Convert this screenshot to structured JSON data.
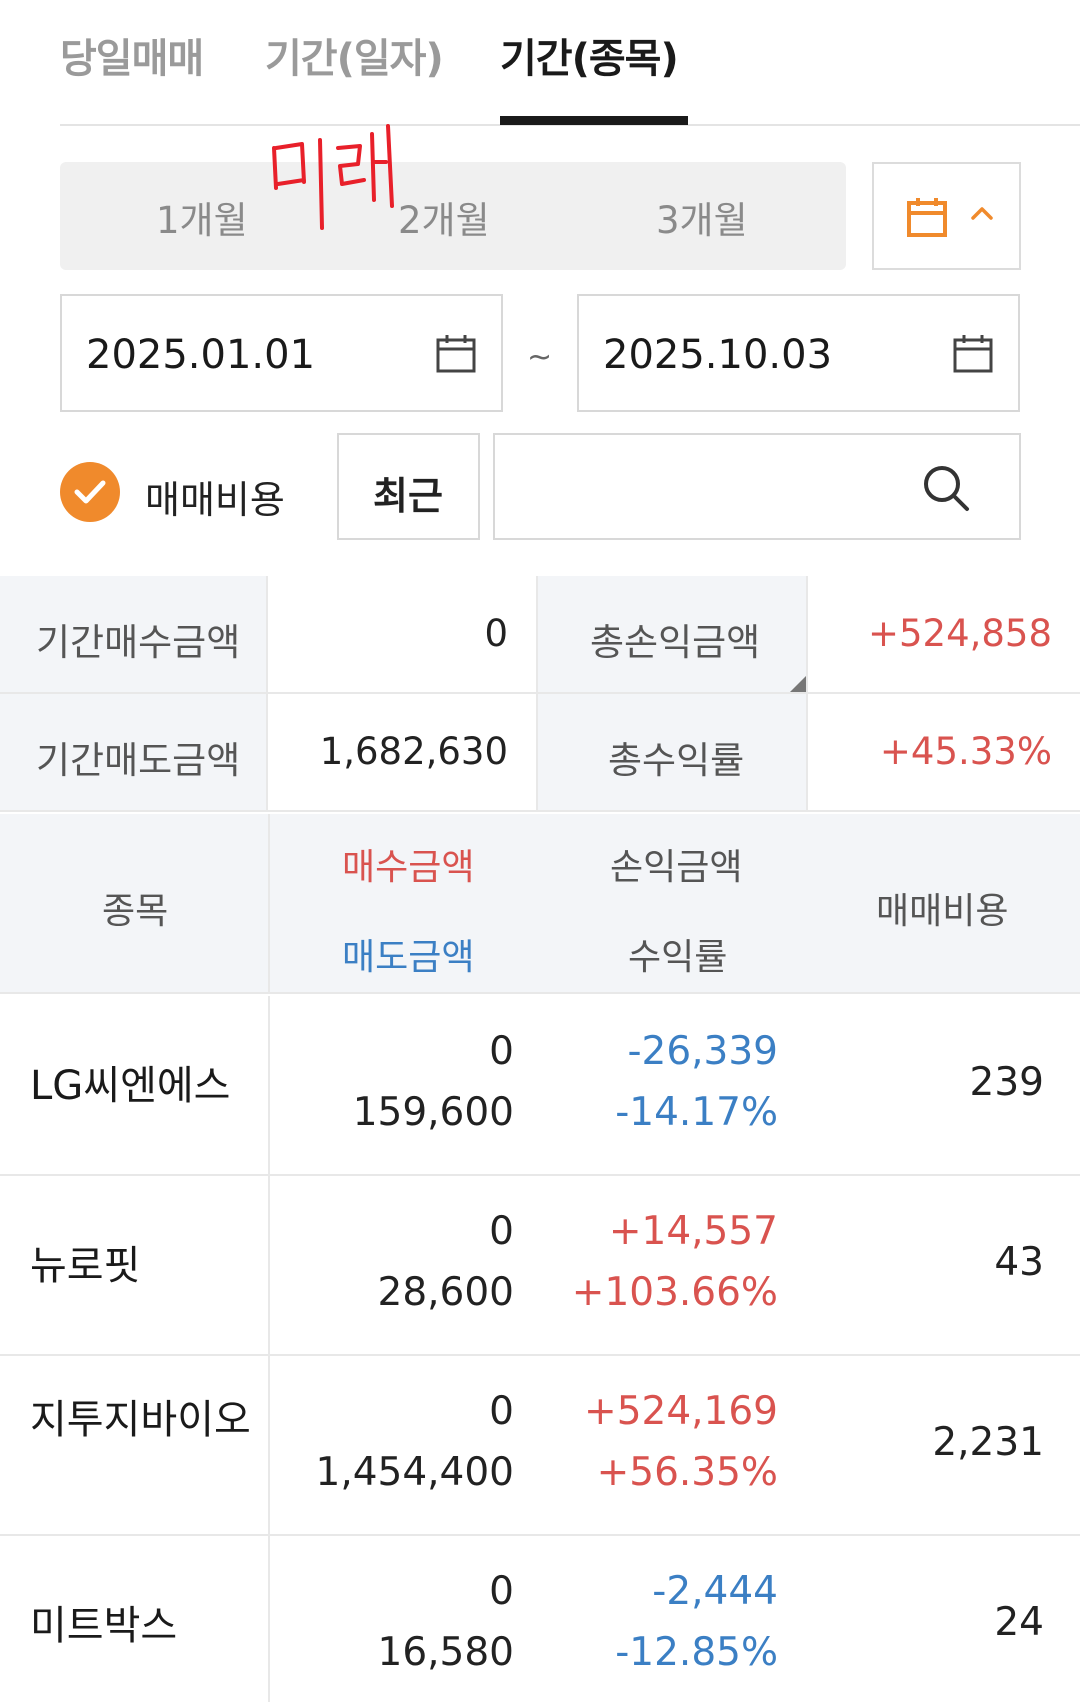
{
  "tabs": [
    {
      "label": "당일매매",
      "active": false
    },
    {
      "label": "기간(일자)",
      "active": false
    },
    {
      "label": "기간(종목)",
      "active": true
    }
  ],
  "period_segments": [
    "1개월",
    "2개월",
    "3개월"
  ],
  "date_range": {
    "from": "2025.01.01",
    "separator": "~",
    "to": "2025.10.03"
  },
  "options": {
    "fee_checkbox_label": "매매비용",
    "fee_checked": true,
    "recent_button": "최근",
    "search_placeholder": ""
  },
  "summary": {
    "period_buy_label": "기간매수금액",
    "period_buy_value": "0",
    "total_pl_label": "총손익금액",
    "total_pl_value": "+524,858",
    "period_sell_label": "기간매도금액",
    "period_sell_value": "1,682,630",
    "total_return_label": "총수익률",
    "total_return_value": "+45.33%"
  },
  "table": {
    "headers": {
      "stock": "종목",
      "buy_amount": "매수금액",
      "sell_amount": "매도금액",
      "profit_amount": "손익금액",
      "return_rate": "수익률",
      "fee": "매매비용"
    },
    "rows": [
      {
        "name": "LG씨엔에스",
        "buy": "0",
        "sell": "159,600",
        "profit": "-26,339",
        "rate": "-14.17%",
        "fee": "239",
        "direction": "down"
      },
      {
        "name": "뉴로핏",
        "buy": "0",
        "sell": "28,600",
        "profit": "+14,557",
        "rate": "+103.66%",
        "fee": "43",
        "direction": "up"
      },
      {
        "name": "지투지바이오",
        "buy": "0",
        "sell": "1,454,400",
        "profit": "+524,169",
        "rate": "+56.35%",
        "fee": "2,231",
        "direction": "up"
      },
      {
        "name": "미트박스",
        "buy": "0",
        "sell": "16,580",
        "profit": "-2,444",
        "rate": "-12.85%",
        "fee": "24",
        "direction": "down"
      }
    ]
  },
  "colors": {
    "up": "#d9534f",
    "down": "#3b7fc4",
    "accent": "#f08a2c",
    "handwriting": "#e8202a"
  },
  "handwritten_note": "미래"
}
